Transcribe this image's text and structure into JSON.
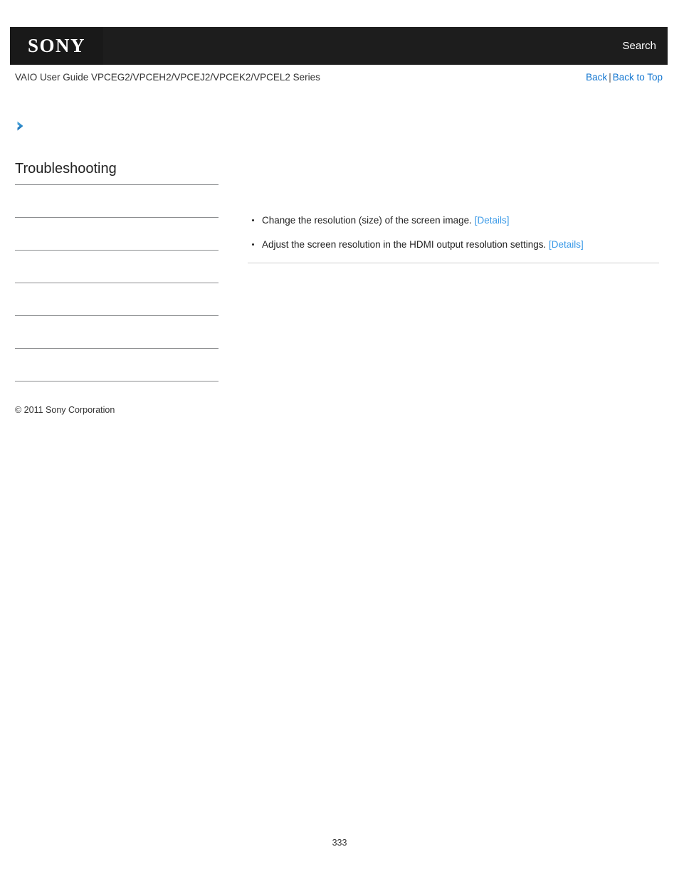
{
  "header": {
    "logo_text": "SONY",
    "search_label": "Search",
    "background_color": "#1d1d1d"
  },
  "title_row": {
    "guide_title": "VAIO User Guide VPCEG2/VPCEH2/VPCEJ2/VPCEK2/VPCEL2 Series",
    "back_label": "Back",
    "separator": "|",
    "back_to_top_label": "Back to Top",
    "link_color": "#1477d1"
  },
  "sidebar": {
    "arrow_icon": "chevron-right-icon",
    "heading": "Troubleshooting",
    "items": [
      {
        "label": ""
      },
      {
        "label": ""
      },
      {
        "label": ""
      },
      {
        "label": ""
      },
      {
        "label": ""
      },
      {
        "label": ""
      }
    ],
    "copyright": "© 2011 Sony Corporation"
  },
  "content": {
    "bullets": [
      {
        "text": "Change the resolution (size) of the screen image.",
        "link_label": "[Details]"
      },
      {
        "text": "Adjust the screen resolution in the HDMI output resolution settings.",
        "link_label": "[Details]"
      }
    ],
    "details_link_color": "#3f9ce8"
  },
  "footer": {
    "page_number": "333"
  }
}
